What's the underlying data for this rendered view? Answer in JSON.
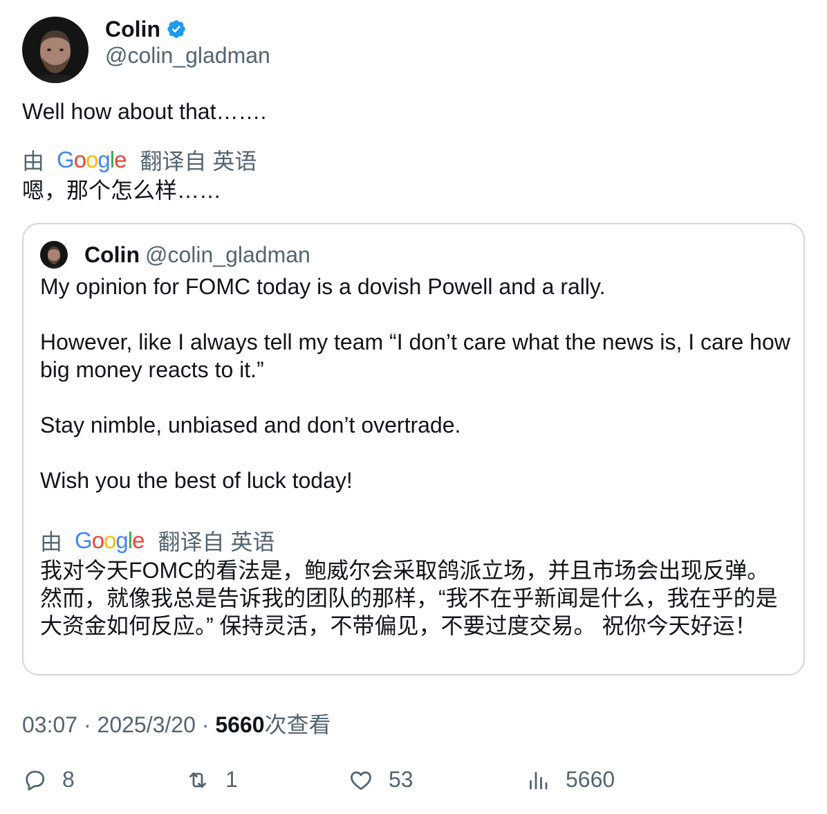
{
  "author": {
    "name": "Colin",
    "handle": "@colin_gladman",
    "verified_icon": "verified-badge-icon"
  },
  "tweet": {
    "text": "Well how about that…….",
    "translation_by": "由",
    "translation_source": "翻译自 英语",
    "translated_text": "嗯，那个怎么样……"
  },
  "quote": {
    "name": "Colin",
    "handle": "@colin_gladman",
    "paragraphs": [
      "My opinion for FOMC today is a dovish Powell and a rally.",
      "However, like I always tell my team “I don’t care what the news is, I care how big money reacts to it.”",
      "Stay nimble, unbiased and don’t overtrade.",
      "Wish you the best of luck today!"
    ],
    "translation_by": "由",
    "translation_source": "翻译自 英语",
    "translated_text": "我对今天FOMC的看法是，鲍威尔会采取鸽派立场，并且市场会出现反弹。然而，就像我总是告诉我的团队的那样，“我不在乎新闻是什么，我在乎的是大资金如何反应。” 保持灵活，不带偏见，不要过度交易。 祝你今天好运！"
  },
  "meta": {
    "time": "03:07",
    "date": "2025/3/20",
    "views_count": "5660",
    "views_label": "次查看"
  },
  "actions": {
    "replies": "8",
    "retweets": "1",
    "likes": "53",
    "views": "5660"
  },
  "colors": {
    "text": "#0f1419",
    "secondary": "#536471",
    "verified": "#1d9bf0",
    "border": "#cfd9de"
  }
}
